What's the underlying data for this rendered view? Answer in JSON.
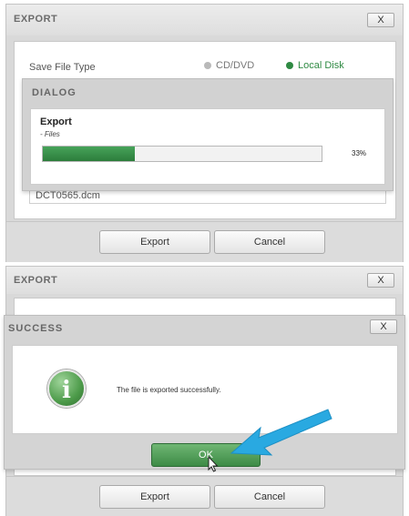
{
  "top_window": {
    "title": "EXPORT",
    "close_label": "X",
    "save_type_label": "Save File Type",
    "option_cd": "CD/DVD",
    "option_local": "Local Disk",
    "file_field_value": "DCT0565.dcm",
    "export_label": "Export",
    "cancel_label": "Cancel"
  },
  "dialog": {
    "title": "DIALOG",
    "heading": "Export",
    "subtext": "- Files",
    "progress_text": "33%",
    "progress_value": 0.33
  },
  "bottom_window": {
    "title": "EXPORT",
    "close_label": "X",
    "export_label": "Export",
    "cancel_label": "Cancel"
  },
  "success": {
    "title": "SUCCESS",
    "close_label": "X",
    "info_glyph": "i",
    "message": "The file is exported successfully.",
    "ok_label": "OK"
  },
  "colors": {
    "accent_green": "#3d8b46",
    "arrow_blue": "#29a9e1"
  },
  "icons": [
    "close-icon",
    "info-icon",
    "cursor-icon",
    "arrow-pointer-icon",
    "radio-icon"
  ]
}
